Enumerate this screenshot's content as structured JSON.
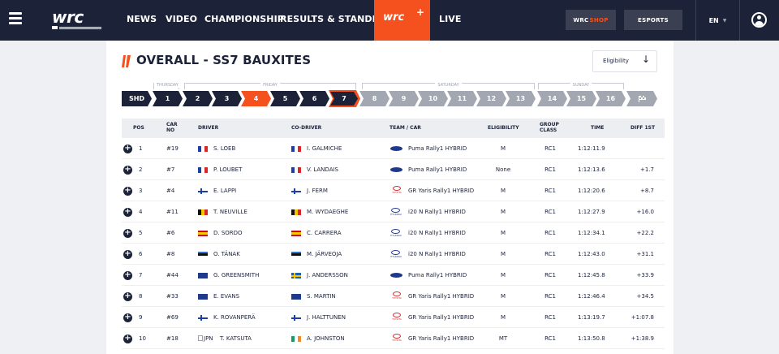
{
  "nav": {
    "items": [
      "NEWS",
      "VIDEO",
      "CHAMPIONSHIP",
      "RESULTS & STANDINGS",
      "LIVE"
    ],
    "plus_label": "wrc",
    "plus_symbol": "+",
    "shop_label": "WRC",
    "shop_accent": "SHOP",
    "esports_label": "ESPORTS",
    "lang": "EN",
    "logo_text": "wrc",
    "accent_color": "#f4511e",
    "bg_color": "#1c2238"
  },
  "page": {
    "title": "OVERALL - SS7 BAUXITES",
    "eligibility_label": "Eligibility",
    "eligibility_icon": "arrow-down-icon"
  },
  "days": [
    {
      "label": "THURSDAY"
    },
    {
      "label": "FRIDAY"
    },
    {
      "label": "SATURDAY"
    },
    {
      "label": "SUNDAY"
    }
  ],
  "stages": [
    {
      "label": "SHD",
      "state": "dark"
    },
    {
      "label": "1",
      "state": "dark"
    },
    {
      "label": "2",
      "state": "dark"
    },
    {
      "label": "3",
      "state": "dark"
    },
    {
      "label": "4",
      "state": "orange"
    },
    {
      "label": "5",
      "state": "dark"
    },
    {
      "label": "6",
      "state": "dark"
    },
    {
      "label": "7",
      "state": "outlined"
    },
    {
      "label": "8",
      "state": "grey"
    },
    {
      "label": "9",
      "state": "grey"
    },
    {
      "label": "10",
      "state": "grey"
    },
    {
      "label": "11",
      "state": "grey"
    },
    {
      "label": "12",
      "state": "grey"
    },
    {
      "label": "13",
      "state": "grey"
    },
    {
      "label": "14",
      "state": "grey"
    },
    {
      "label": "15",
      "state": "grey"
    },
    {
      "label": "16",
      "state": "grey"
    },
    {
      "label": "",
      "state": "grey",
      "icon": "finish-flag-icon"
    }
  ],
  "table": {
    "headers": {
      "pos": "POS",
      "car_no_1": "CAR",
      "car_no_2": "NO",
      "driver": "DRIVER",
      "codriver": "CO-DRIVER",
      "team": "TEAM / CAR",
      "eligibility": "ELIGIBILITY",
      "group_1": "GROUP",
      "group_2": "CLASS",
      "time": "TIME",
      "diff": "DIFF 1ST"
    },
    "rows": [
      {
        "pos": "1",
        "car": "#19",
        "driver": "S. LOEB",
        "driver_flag": "fr",
        "codriver": "I. GALMICHE",
        "codriver_flag": "fr",
        "brand": "ford",
        "team": "Puma Rally1 HYBRID",
        "elig": "M",
        "group": "RC1",
        "time": "1:12:11.9",
        "diff": ""
      },
      {
        "pos": "2",
        "car": "#7",
        "driver": "P. LOUBET",
        "driver_flag": "fr",
        "codriver": "V. LANDAIS",
        "codriver_flag": "fr",
        "brand": "ford",
        "team": "Puma Rally1 HYBRID",
        "elig": "None",
        "group": "RC1",
        "time": "1:12:13.6",
        "diff": "+1.7"
      },
      {
        "pos": "3",
        "car": "#4",
        "driver": "E. LAPPI",
        "driver_flag": "fi",
        "codriver": "J. FERM",
        "codriver_flag": "fi",
        "brand": "toyota",
        "team": "GR Yaris Rally1 HYBRID",
        "elig": "M",
        "group": "RC1",
        "time": "1:12:20.6",
        "diff": "+8.7"
      },
      {
        "pos": "4",
        "car": "#11",
        "driver": "T. NEUVILLE",
        "driver_flag": "be",
        "codriver": "M. WYDAEGHE",
        "codriver_flag": "be",
        "brand": "hyundai",
        "team": "i20 N Rally1 HYBRID",
        "elig": "M",
        "group": "RC1",
        "time": "1:12:27.9",
        "diff": "+16.0"
      },
      {
        "pos": "5",
        "car": "#6",
        "driver": "D. SORDO",
        "driver_flag": "es",
        "codriver": "C. CARRERA",
        "codriver_flag": "es",
        "brand": "hyundai",
        "team": "i20 N Rally1 HYBRID",
        "elig": "M",
        "group": "RC1",
        "time": "1:12:34.1",
        "diff": "+22.2"
      },
      {
        "pos": "6",
        "car": "#8",
        "driver": "O. TÄNAK",
        "driver_flag": "ee",
        "codriver": "M. JÄRVEOJA",
        "codriver_flag": "ee",
        "brand": "hyundai",
        "team": "i20 N Rally1 HYBRID",
        "elig": "M",
        "group": "RC1",
        "time": "1:12:43.0",
        "diff": "+31.1"
      },
      {
        "pos": "7",
        "car": "#44",
        "driver": "G. GREENSMITH",
        "driver_flag": "gb",
        "codriver": "J. ANDERSSON",
        "codriver_flag": "se",
        "brand": "ford",
        "team": "Puma Rally1 HYBRID",
        "elig": "M",
        "group": "RC1",
        "time": "1:12:45.8",
        "diff": "+33.9"
      },
      {
        "pos": "8",
        "car": "#33",
        "driver": "E. EVANS",
        "driver_flag": "gb",
        "codriver": "S. MARTIN",
        "codriver_flag": "gb",
        "brand": "toyota",
        "team": "GR Yaris Rally1 HYBRID",
        "elig": "M",
        "group": "RC1",
        "time": "1:12:46.4",
        "diff": "+34.5"
      },
      {
        "pos": "9",
        "car": "#69",
        "driver": "K. ROVANPERÄ",
        "driver_flag": "fi",
        "codriver": "J. HALTTUNEN",
        "codriver_flag": "fi",
        "brand": "toyota",
        "team": "GR Yaris Rally1 HYBRID",
        "elig": "M",
        "group": "RC1",
        "time": "1:13:19.7",
        "diff": "+1:07.8"
      },
      {
        "pos": "10",
        "car": "#18",
        "driver": "T. KATSUTA",
        "driver_flag": "jpn",
        "driver_flag_alt": "JPN",
        "codriver": "A. JOHNSTON",
        "codriver_flag": "ie",
        "brand": "toyota",
        "team": "GR Yaris Rally1 HYBRID",
        "elig": "MT",
        "group": "RC1",
        "time": "1:13:50.8",
        "diff": "+1:38.9"
      }
    ]
  }
}
